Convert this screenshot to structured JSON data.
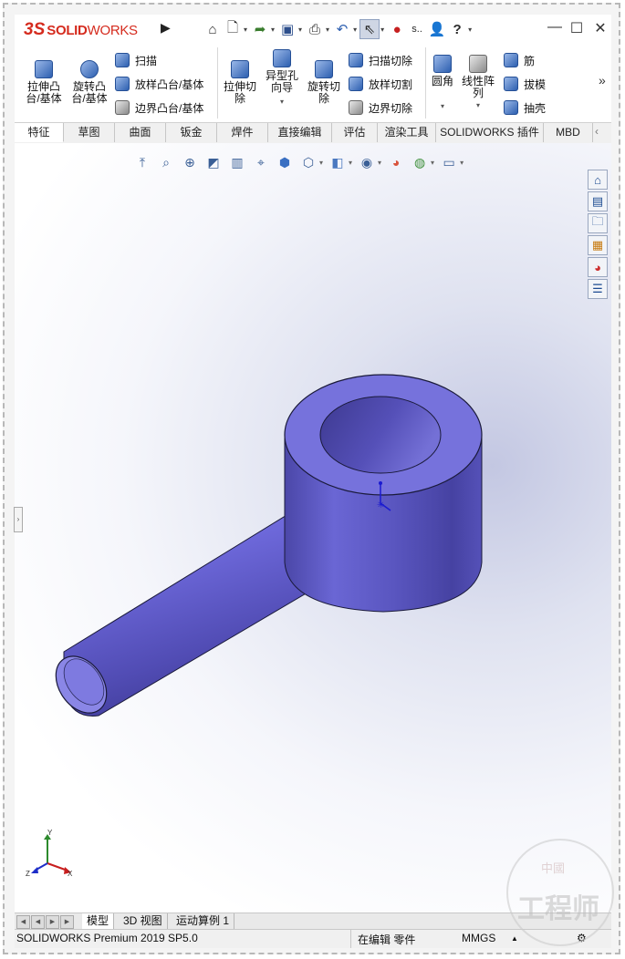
{
  "app": {
    "logo_ds": "3S",
    "logo_text_bold": "SOLID",
    "logo_text_light": "WORKS",
    "quick_access": [
      "home-icon",
      "new-document-icon",
      "open-icon",
      "save-icon",
      "print-icon",
      "undo-icon",
      "select-cursor-icon",
      "traffic-light-icon",
      "user-icon",
      "help-icon"
    ],
    "quick_trunc": "s..",
    "help_label": "?"
  },
  "ribbon": {
    "extrude_boss": "拉伸凸\n台/基体",
    "revolve_boss": "旋转凸\n台/基体",
    "sweep": "扫描",
    "loft_boss": "放样凸台/基体",
    "boundary_boss": "边界凸台/基体",
    "extrude_cut": "拉伸切\n除",
    "hole_wizard": "异型孔\n向导",
    "revolve_cut": "旋转切\n除",
    "swept_cut": "扫描切除",
    "lofted_cut": "放样切割",
    "boundary_cut": "边界切除",
    "fillet": "圆角",
    "linear_pattern": "线性阵\n列",
    "rib": "筋",
    "draft": "拔模",
    "shell": "抽壳",
    "more": "»"
  },
  "tabs": [
    "特征",
    "草图",
    "曲面",
    "钣金",
    "焊件",
    "直接编辑",
    "评估",
    "渲染工具",
    "SOLIDWORKS 插件",
    "MBD"
  ],
  "active_tab": "特征",
  "bottom_tabs": [
    "模型",
    "3D 视图",
    "运动算例 1"
  ],
  "active_bottom_tab": "模型",
  "status": {
    "version": "SOLIDWORKS Premium 2019 SP5.0",
    "editing": "在编辑 零件",
    "units": "MMGS"
  },
  "triad": {
    "x": "X",
    "y": "Y",
    "z": "Z"
  },
  "watermark": {
    "top": "中國",
    "main": "工程师"
  },
  "colors": {
    "part": "#6b66d6",
    "part_dark": "#4a45a8",
    "accent_red": "#d52b1e"
  }
}
